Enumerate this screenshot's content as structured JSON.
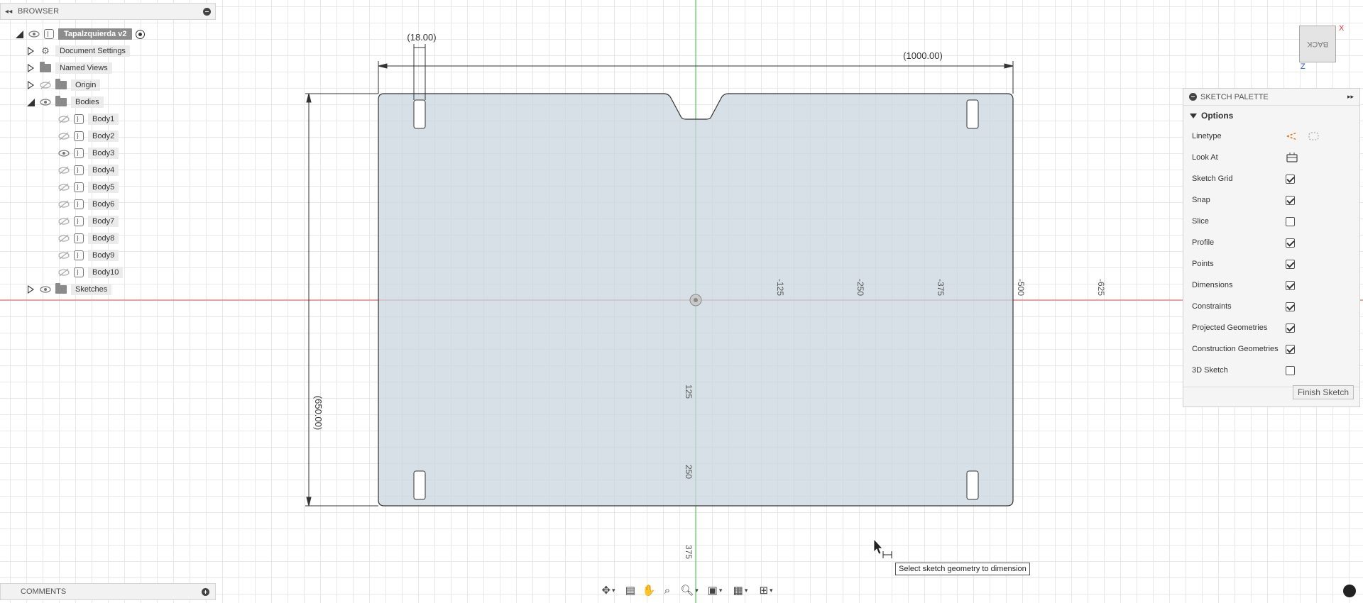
{
  "browser": {
    "title": "BROWSER",
    "root": "Tapalzquierda v2",
    "items": {
      "document_settings": "Document Settings",
      "named_views": "Named Views",
      "origin": "Origin",
      "bodies": "Bodies",
      "sketches": "Sketches"
    },
    "bodies": [
      "Body1",
      "Body2",
      "Body3",
      "Body4",
      "Body5",
      "Body6",
      "Body7",
      "Body8",
      "Body9",
      "Body10"
    ]
  },
  "comments": {
    "title": "COMMENTS"
  },
  "sketch": {
    "dimensions": {
      "slot_width": "(18.00)",
      "width": "(1000.00)",
      "height": "(650.00)"
    },
    "x_ticks": [
      "-125",
      "-250",
      "-375",
      "-500",
      "-625"
    ],
    "y_ticks": [
      "125",
      "250",
      "375"
    ],
    "colors": {
      "x_axis": "#e05050",
      "y_axis": "#39c04a",
      "profile_fill": "#c8d6de"
    }
  },
  "palette": {
    "title": "SKETCH PALETTE",
    "section": "Options",
    "rows": {
      "linetype": "Linetype",
      "look_at": "Look At",
      "sketch_grid": "Sketch Grid",
      "snap": "Snap",
      "slice": "Slice",
      "profile": "Profile",
      "points": "Points",
      "dimensions": "Dimensions",
      "constraints": "Constraints",
      "projected_geometries": "Projected Geometries",
      "construction_geometries": "Construction Geometries",
      "sketch_3d": "3D Sketch"
    },
    "checked": {
      "sketch_grid": true,
      "snap": true,
      "slice": false,
      "profile": true,
      "points": true,
      "dimensions": true,
      "constraints": true,
      "projected_geometries": true,
      "construction_geometries": true,
      "sketch_3d": false
    },
    "finish_button": "Finish Sketch"
  },
  "tooltip": "Select sketch geometry to dimension",
  "viewcube": {
    "face": "BACK",
    "x_label": "X",
    "z_label": "Z"
  }
}
